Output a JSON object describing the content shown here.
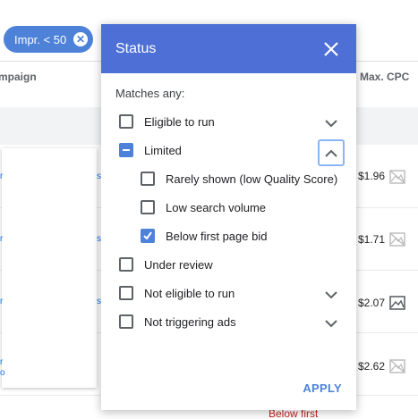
{
  "filter_chip": {
    "label": "Impr. < 50",
    "close_icon": "close-circle-icon"
  },
  "table": {
    "headers": {
      "campaign": "mpaign",
      "max_cpc": "Max. CPC"
    },
    "rows": [
      {
        "max_cpc": "$1.96",
        "icon": "image-icon-disabled"
      },
      {
        "max_cpc": "$1.71",
        "icon": "image-icon-disabled"
      },
      {
        "max_cpc": "$2.07",
        "icon": "image-icon"
      },
      {
        "max_cpc": "$2.62",
        "icon": "image-icon-disabled"
      }
    ],
    "footer_status": "Below first"
  },
  "modal": {
    "title": "Status",
    "matches_label": "Matches any:",
    "options": [
      {
        "label": "Eligible to run",
        "state": "unchecked",
        "expandable": true
      },
      {
        "label": "Limited",
        "state": "indeterminate",
        "expandable": true,
        "expanded": true,
        "children": [
          {
            "label": "Rarely shown (low Quality Score)",
            "state": "unchecked"
          },
          {
            "label": "Low search volume",
            "state": "unchecked"
          },
          {
            "label": "Below first page bid",
            "state": "checked"
          }
        ]
      },
      {
        "label": "Under review",
        "state": "unchecked",
        "expandable": false
      },
      {
        "label": "Not eligible to run",
        "state": "unchecked",
        "expandable": true
      },
      {
        "label": "Not triggering ads",
        "state": "unchecked",
        "expandable": true
      }
    ],
    "apply_label": "APPLY"
  },
  "colors": {
    "header_blue": "#4d6fd6",
    "accent_blue": "#4d82d8",
    "error_red": "#c5221f"
  }
}
